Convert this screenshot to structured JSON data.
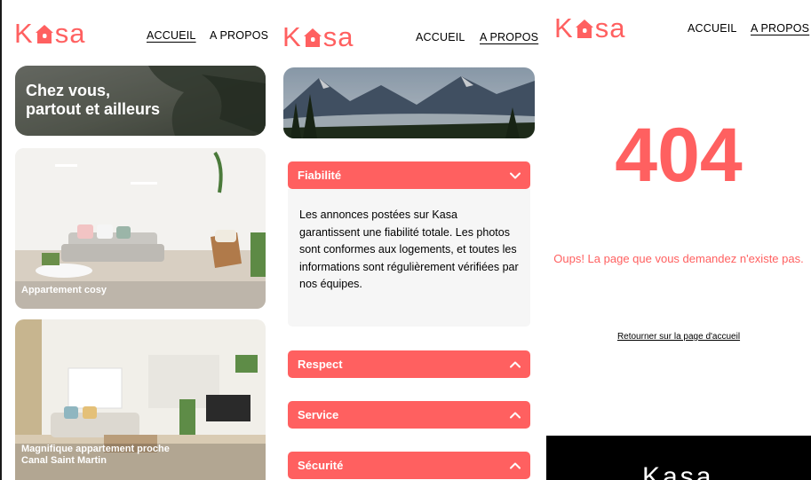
{
  "brand": {
    "logo_left": "K",
    "logo_right": "sa",
    "accent": "#FF6060"
  },
  "nav": {
    "home": "ACCUEIL",
    "about": "A PROPOS"
  },
  "home": {
    "banner_title": "Chez vous,\npartout et ailleurs",
    "cards": [
      {
        "title": "Appartement cosy"
      },
      {
        "title": "Magnifique appartement proche\nCanal Saint Martin"
      }
    ]
  },
  "about": {
    "items": [
      {
        "title": "Fiabilité",
        "expanded": true,
        "icon": "chevron-down-icon",
        "body": "Les annonces postées sur Kasa garantissent une fiabilité totale. Les photos sont conformes aux logements, et toutes les informations sont régulièrement vérifiées par nos équipes."
      },
      {
        "title": "Respect",
        "expanded": false,
        "icon": "chevron-up-icon"
      },
      {
        "title": "Service",
        "expanded": false,
        "icon": "chevron-up-icon"
      },
      {
        "title": "Sécurité",
        "expanded": false,
        "icon": "chevron-up-icon"
      }
    ]
  },
  "notfound": {
    "code": "404",
    "message": "Oups! La page que vous demandez n'existe pas.",
    "link": "Retourner sur la page d'accueil"
  },
  "footer": {
    "logo": "Kasa"
  }
}
